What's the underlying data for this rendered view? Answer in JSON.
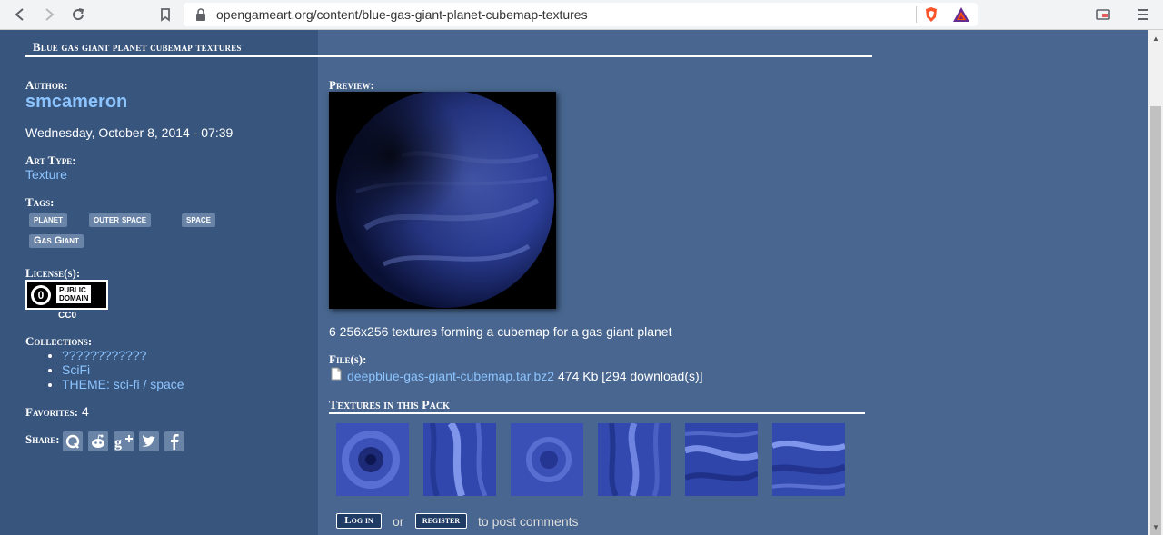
{
  "browser": {
    "url": "opengameart.org/content/blue-gas-giant-planet-cubemap-textures"
  },
  "page": {
    "title": "Blue gas giant planet cubemap textures"
  },
  "sidebar": {
    "author_label": "Author:",
    "author": "smcameron",
    "date": "Wednesday, October 8, 2014 - 07:39",
    "art_type_label": "Art Type:",
    "art_type": "Texture",
    "tags_label": "Tags:",
    "tags": [
      "planet",
      "outer space",
      "space",
      "Gas Giant"
    ],
    "license_label": "License(s):",
    "license_badge_text": [
      "PUBLIC",
      "DOMAIN"
    ],
    "license_name": "CC0",
    "collections_label": "Collections:",
    "collections": [
      "????????????",
      "SciFi",
      "THEME: sci-fi / space"
    ],
    "favorites_label": "Favorites:",
    "favorites": "4",
    "share_label": "Share:"
  },
  "main": {
    "preview_label": "Preview:",
    "description": "6 256x256 textures forming a cubemap for a gas giant planet",
    "files_label": "File(s):",
    "file_name": "deepblue-gas-giant-cubemap.tar.bz2",
    "file_info": "474 Kb [294 download(s)]",
    "textures_heading": "Textures in this Pack",
    "login_label": "Log in",
    "or_text": "or",
    "register_label": "register",
    "post_comments_text": "to post comments"
  },
  "colors": {
    "sidebar_bg": "#38557d",
    "content_bg": "#48668f",
    "link": "#8cc4ff"
  }
}
